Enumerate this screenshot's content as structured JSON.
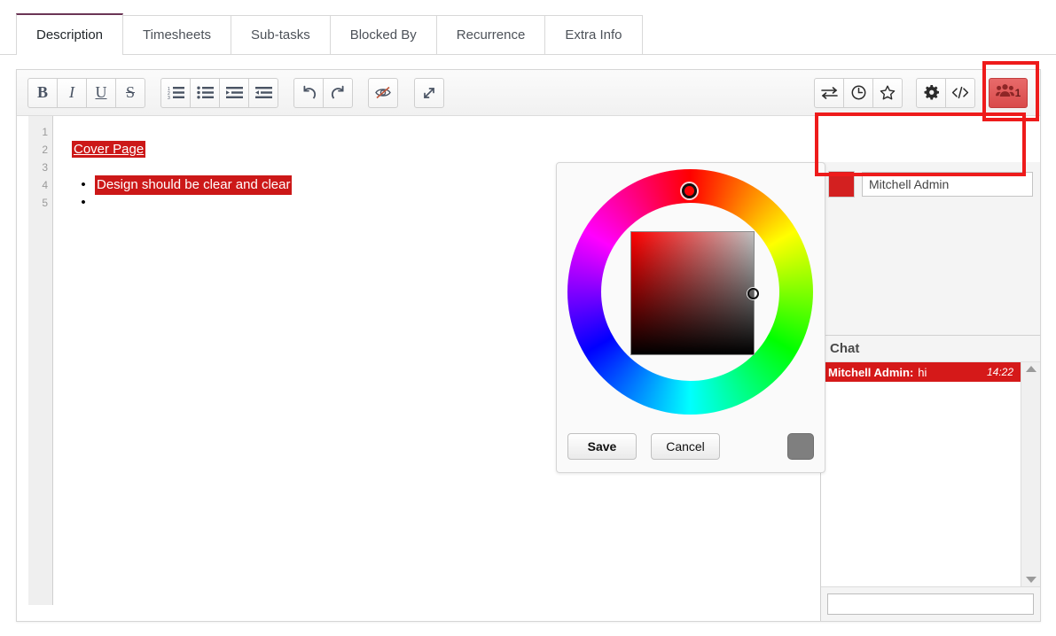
{
  "tabs": [
    {
      "label": "Description",
      "active": true
    },
    {
      "label": "Timesheets",
      "active": false
    },
    {
      "label": "Sub-tasks",
      "active": false
    },
    {
      "label": "Blocked By",
      "active": false
    },
    {
      "label": "Recurrence",
      "active": false
    },
    {
      "label": "Extra Info",
      "active": false
    }
  ],
  "toolbar": {
    "bold": "B",
    "italic": "I",
    "underline": "U",
    "strike": "S",
    "ordered_list": "ordered-list-icon",
    "unordered_list": "unordered-list-icon",
    "indent": "indent-icon",
    "outdent": "outdent-icon",
    "undo": "undo-icon",
    "redo": "redo-icon",
    "hide": "eye-slash-icon",
    "expand": "expand-icon",
    "transfer": "transfer-arrows-icon",
    "history": "clock-icon",
    "favorite": "star-icon",
    "settings": "gear-icon",
    "source_code": "code-icon",
    "collaborators": "users-icon",
    "collaborators_count": "1"
  },
  "editor": {
    "line_numbers": [
      "1",
      "2",
      "3",
      "4",
      "5"
    ],
    "lines": [
      {
        "type": "blank",
        "text": ""
      },
      {
        "type": "heading",
        "text": "Cover Page",
        "highlight": true,
        "underline": true
      },
      {
        "type": "blank",
        "text": ""
      },
      {
        "type": "bullet",
        "text": "Design should be clear and clear",
        "highlight": true
      },
      {
        "type": "bullet",
        "text": ""
      }
    ]
  },
  "color_picker": {
    "save_label": "Save",
    "cancel_label": "Cancel",
    "preview_color": "#7f7f7f",
    "selected_hue_color": "#ff0000",
    "hue_handle_position_deg": 0,
    "wheel_icon": "color-wheel"
  },
  "sidebar": {
    "user": {
      "color": "#d32020",
      "name": "Mitchell Admin"
    },
    "chat": {
      "title": "Chat",
      "messages": [
        {
          "author": "Mitchell Admin:",
          "text": "hi",
          "time": "14:22"
        }
      ],
      "input_value": "",
      "input_placeholder": ""
    }
  },
  "annotations": {
    "users_button_box": "red-highlight-box",
    "user_row_box": "red-highlight-box",
    "color": "#ee1b1b"
  }
}
